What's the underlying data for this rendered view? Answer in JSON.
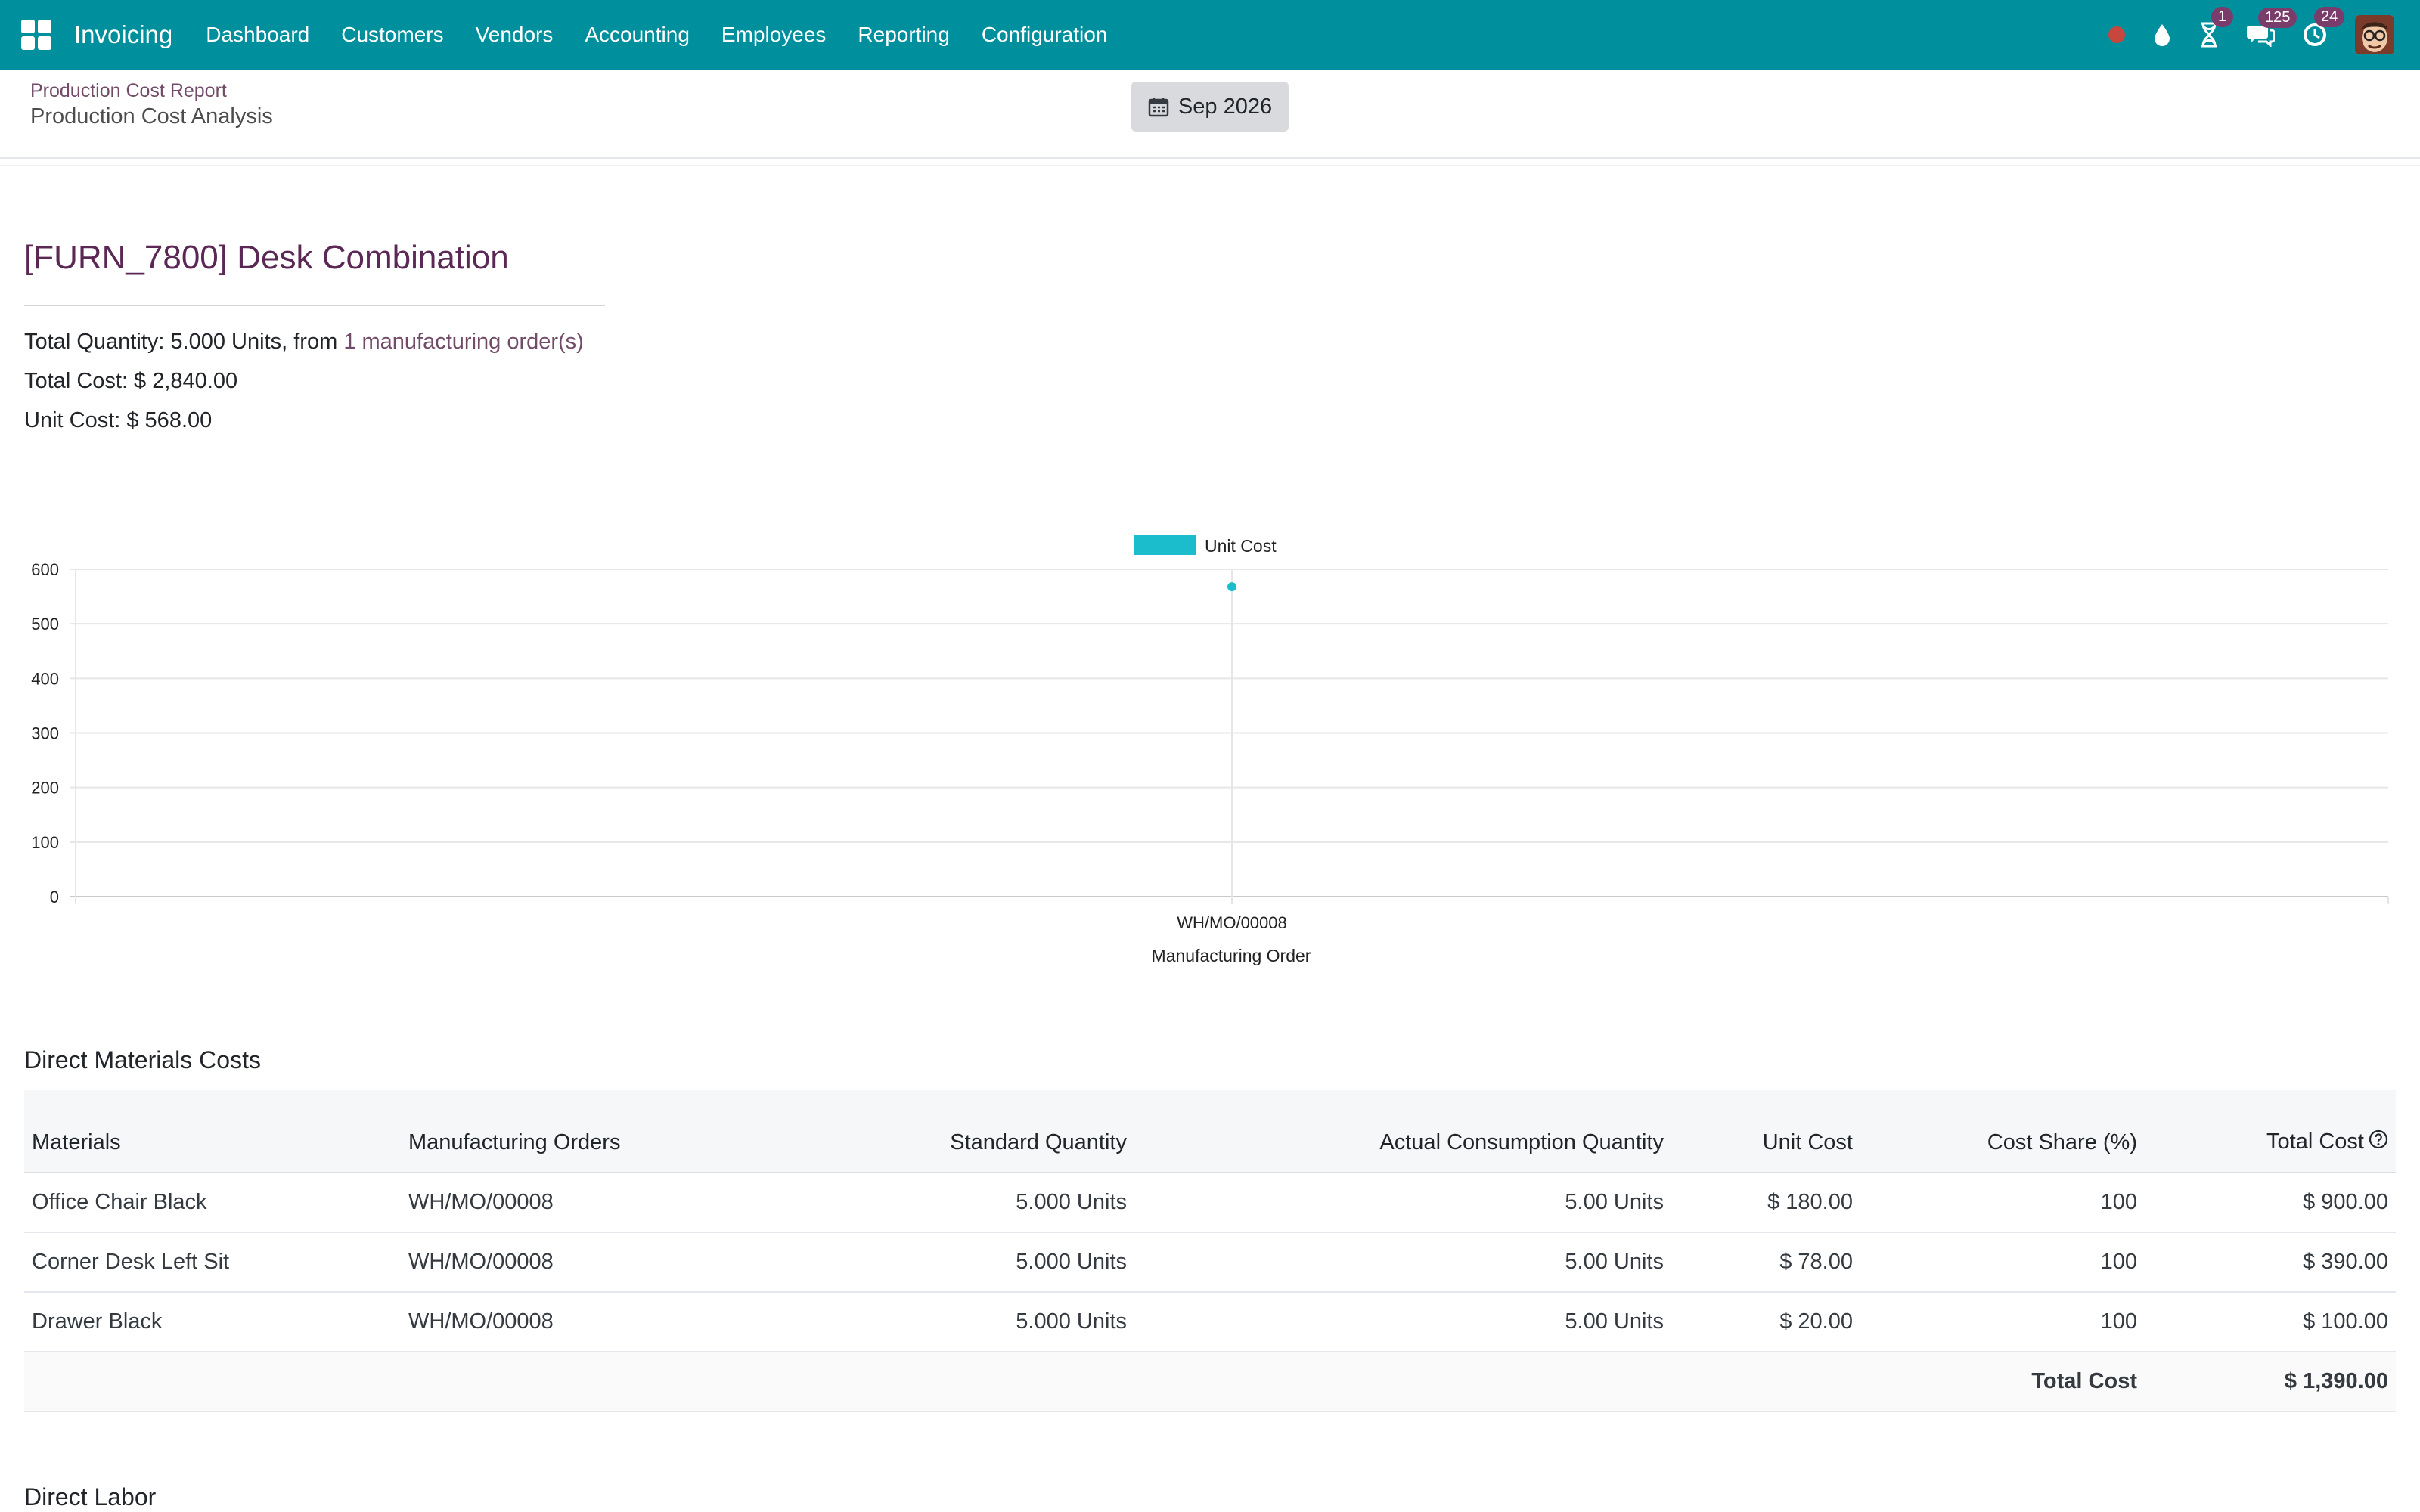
{
  "nav": {
    "brand": "Invoicing",
    "menu": [
      "Dashboard",
      "Customers",
      "Vendors",
      "Accounting",
      "Employees",
      "Reporting",
      "Configuration"
    ],
    "badges": {
      "activities": "1",
      "messages": "125",
      "updates": "24"
    }
  },
  "control": {
    "breadcrumb_parent": "Production Cost Report",
    "breadcrumb_current": "Production Cost Analysis",
    "period": "Sep 2026"
  },
  "summary": {
    "product_title": "[FURN_7800] Desk Combination",
    "qty_prefix": "Total Quantity: 5.000 Units, from ",
    "mo_link": "1 manufacturing order(s)",
    "total_cost": "Total Cost: $ 2,840.00",
    "unit_cost": "Unit Cost: $ 568.00"
  },
  "chart_data": {
    "type": "line",
    "categories": [
      "WH/MO/00008"
    ],
    "series": [
      {
        "name": "Unit Cost",
        "values": [
          568
        ],
        "color": "#1bbccc"
      }
    ],
    "xlabel": "Manufacturing Order",
    "ylabel": "",
    "ylim": [
      0,
      600
    ],
    "yticks": [
      0,
      100,
      200,
      300,
      400,
      500,
      600
    ],
    "grid": true,
    "legend": "top-center"
  },
  "materials": {
    "section_title": "Direct Materials Costs",
    "columns": [
      "Materials",
      "Manufacturing Orders",
      "Standard Quantity",
      "Actual Consumption Quantity",
      "Unit Cost",
      "Cost Share (%)",
      "Total Cost"
    ],
    "rows": [
      [
        "Office Chair Black",
        "WH/MO/00008",
        "5.000 Units",
        "5.00 Units",
        "$ 180.00",
        "100",
        "$ 900.00"
      ],
      [
        "Corner Desk Left Sit",
        "WH/MO/00008",
        "5.000 Units",
        "5.00 Units",
        "$ 78.00",
        "100",
        "$ 390.00"
      ],
      [
        "Drawer Black",
        "WH/MO/00008",
        "5.000 Units",
        "5.00 Units",
        "$ 20.00",
        "100",
        "$ 100.00"
      ]
    ],
    "total_label": "Total Cost",
    "total_value": "$ 1,390.00"
  },
  "labor": {
    "section_title": "Direct Labor"
  }
}
